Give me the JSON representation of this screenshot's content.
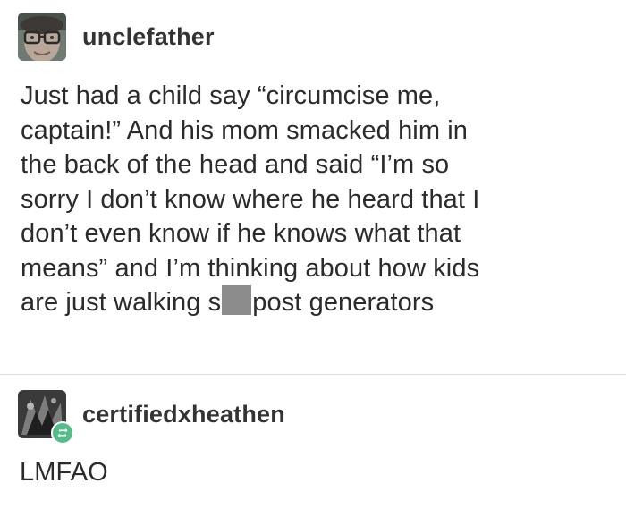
{
  "post_1": {
    "username": "unclefather",
    "avatar_icon": "user-avatar-glasses-icon",
    "body_lines": [
      "Just had a child say “circumcise me,",
      "captain!” And his mom smacked him in",
      "the back of the head and said “I’m so",
      "sorry I don’t know where he heard that I",
      "don’t even know if he knows what that",
      "means” and I’m thinking about how kids"
    ],
    "last_line_before_censor": "are just walking s",
    "last_line_after_censor": "post generators",
    "censor_color": "#8c8c8c"
  },
  "post_2": {
    "username": "certifiedxheathen",
    "avatar_icon": "user-avatar-dark-icon",
    "badge_icon": "reblog-icon",
    "badge_color": "#56bc8a",
    "body": "LMFAO"
  }
}
